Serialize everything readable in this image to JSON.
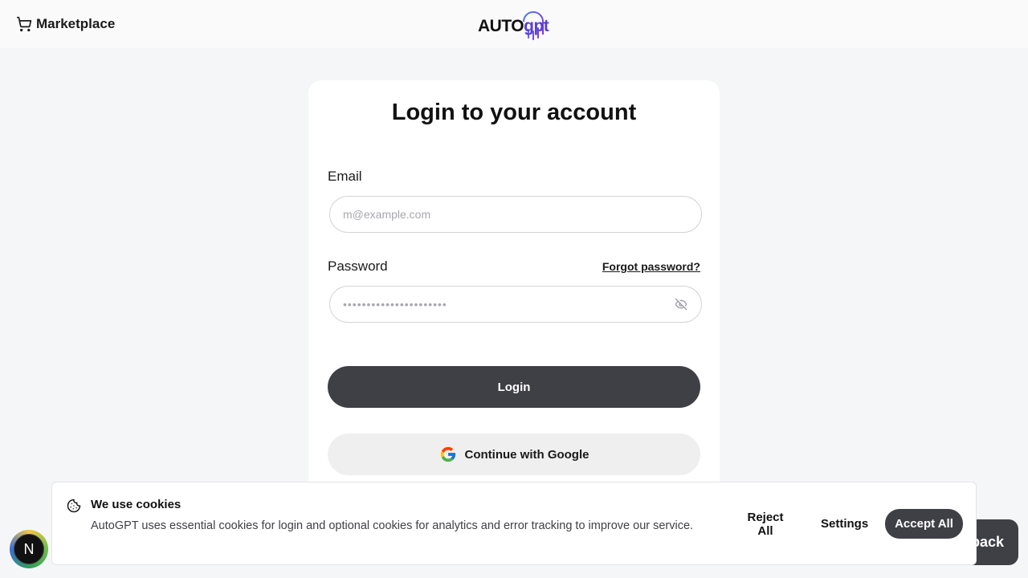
{
  "header": {
    "marketplace_label": "Marketplace",
    "marketplace_icon": "cart-icon",
    "logo_text_main": "AUTO",
    "logo_text_accent": "gpt"
  },
  "login": {
    "title": "Login to your account",
    "email_label": "Email",
    "email_placeholder": "m@example.com",
    "email_value": "",
    "password_label": "Password",
    "password_value": "••••••••••••••••••••••",
    "forgot_label": "Forgot password?",
    "eye_icon": "eye-off-icon",
    "login_button": "Login",
    "google_button": "Continue with Google"
  },
  "cookie": {
    "title": "We use cookies",
    "text": "AutoGPT uses essential cookies for login and optional cookies for analytics and error tracking to improve our service.",
    "reject": "Reject All",
    "settings": "Settings",
    "accept": "Accept All"
  },
  "feedback": {
    "label_visible": "back"
  },
  "dev_badge": {
    "letter": "N"
  },
  "colors": {
    "background": "#f5f6f7",
    "primary_button": "#3f3f46",
    "secondary_button": "#efefef",
    "logo_accent": "#5b3fd6"
  }
}
